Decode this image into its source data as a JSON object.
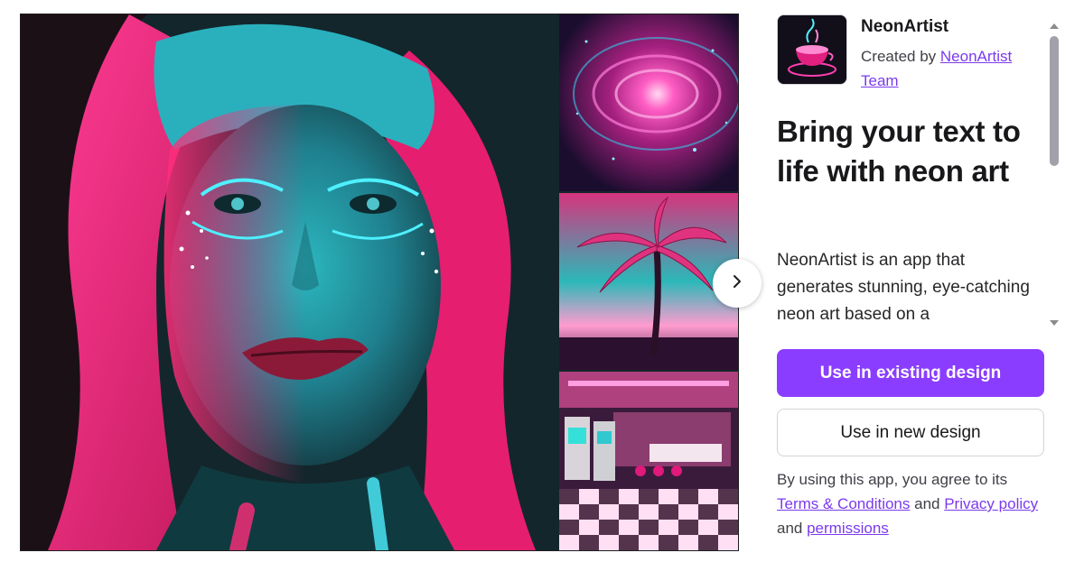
{
  "gallery": {
    "main_image_alt": "neon portrait",
    "thumbnails": [
      "neon galaxy",
      "neon palm tree",
      "neon arcade diner"
    ],
    "next_icon": "chevron-right-icon"
  },
  "app": {
    "name": "NeonArtist",
    "created_by_prefix": "Created by ",
    "creator_link": "NeonArtist Team",
    "headline": "Bring your text to life with neon art",
    "description": "NeonArtist is an app that generates stunning, eye-catching neon art based on a"
  },
  "actions": {
    "primary_label": "Use in existing design",
    "secondary_label": "Use in new design"
  },
  "terms": {
    "prefix": "By using this app, you agree to its ",
    "terms_link": "Terms & Conditions",
    "and_1": " and ",
    "privacy_link": "Privacy policy",
    "and_2": " and ",
    "permissions_link": "permissions"
  },
  "colors": {
    "accent": "#8b3dff",
    "link": "#7c3aed",
    "neon_pink": "#ff2a8a",
    "neon_cyan": "#2de2e6"
  }
}
